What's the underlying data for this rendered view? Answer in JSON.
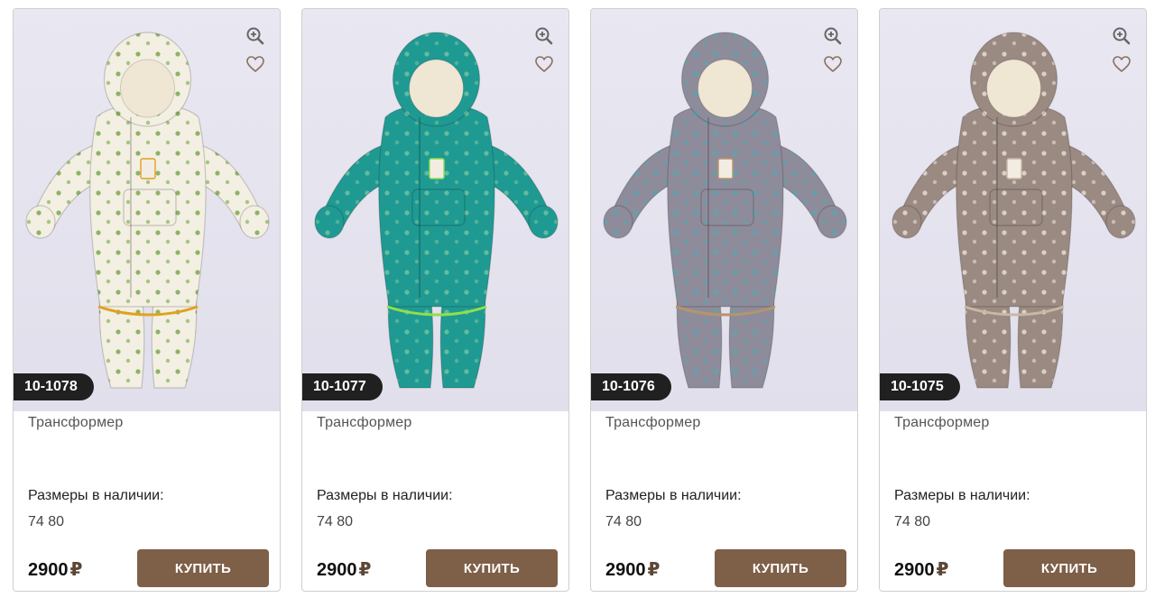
{
  "colors": {
    "accent": "#7e5f48",
    "badge_bg": "#202020",
    "currency": "#5c4636"
  },
  "icons": {
    "zoom": "zoom-in-icon",
    "favorite": "heart-icon"
  },
  "products": [
    {
      "sku": "10-1078",
      "name": "Трансформер",
      "sizes_title": "Размеры в наличии:",
      "sizes": "74 80",
      "price": "2900",
      "currency": "₽",
      "buy_label": "КУПИТЬ",
      "suit_color": "#f3efe2",
      "suit_pattern": "#6a9e3a",
      "suit_accent": "#e0a21f"
    },
    {
      "sku": "10-1077",
      "name": "Трансформер",
      "sizes_title": "Размеры в наличии:",
      "sizes": "74 80",
      "price": "2900",
      "currency": "₽",
      "buy_label": "КУПИТЬ",
      "suit_color": "#1f9a93",
      "suit_pattern": "#7bc7a0",
      "suit_accent": "#8ee04a"
    },
    {
      "sku": "10-1076",
      "name": "Трансформер",
      "sizes_title": "Размеры в наличии:",
      "sizes": "74 80",
      "price": "2900",
      "currency": "₽",
      "buy_label": "КУПИТЬ",
      "suit_color": "#8e8c9b",
      "suit_pattern": "#4fa9b3",
      "suit_accent": "#b8946a"
    },
    {
      "sku": "10-1075",
      "name": "Трансформер",
      "sizes_title": "Размеры в наличии:",
      "sizes": "74 80",
      "price": "2900",
      "currency": "₽",
      "buy_label": "КУПИТЬ",
      "suit_color": "#9a8a82",
      "suit_pattern": "#efe7df",
      "suit_accent": "#c9b7a6"
    }
  ]
}
